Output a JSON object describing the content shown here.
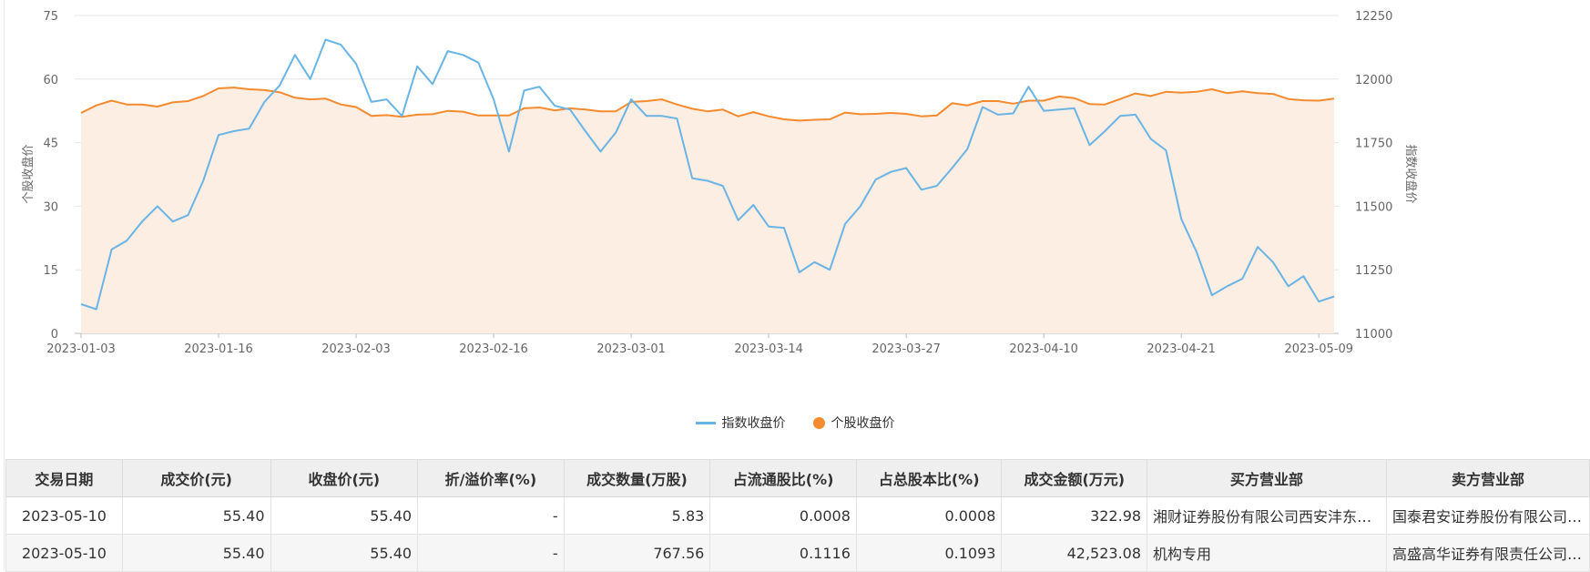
{
  "chart_data": {
    "type": "line",
    "ylabel": "个股收盘价",
    "y2label": "指数收盘价",
    "ylim": [
      0,
      75
    ],
    "y2lim": [
      11000,
      12250
    ],
    "yticks": [
      "0",
      "15",
      "30",
      "45",
      "60",
      "75"
    ],
    "y2ticks": [
      "11000",
      "11250",
      "11500",
      "11750",
      "12000",
      "12250"
    ],
    "xtick_labels": [
      "2023-01-03",
      "2023-01-16",
      "2023-02-03",
      "2023-02-16",
      "2023-03-01",
      "2023-03-14",
      "2023-03-27",
      "2023-04-10",
      "2023-04-21",
      "2023-05-09"
    ],
    "xtick_index": [
      0,
      9,
      18,
      27,
      36,
      45,
      54,
      63,
      72,
      81
    ],
    "legend_position": "bottom",
    "series": [
      {
        "name": "指数收盘价",
        "axis": "right",
        "color": "#6ab4e5",
        "values": [
          11115,
          11095,
          11330,
          11365,
          11440,
          11500,
          11440,
          11465,
          11600,
          11780,
          11795,
          11805,
          11910,
          11975,
          12095,
          12000,
          12155,
          12135,
          12060,
          11910,
          11920,
          11855,
          12050,
          11980,
          12110,
          12095,
          12065,
          11920,
          11715,
          11955,
          11970,
          11895,
          11880,
          11795,
          11715,
          11790,
          11920,
          11855,
          11855,
          11845,
          11610,
          11600,
          11580,
          11445,
          11505,
          11420,
          11415,
          11240,
          11280,
          11250,
          11430,
          11500,
          11605,
          11635,
          11650,
          11565,
          11580,
          11650,
          11725,
          11890,
          11860,
          11865,
          11970,
          11875,
          11880,
          11885,
          11740,
          11795,
          11855,
          11860,
          11765,
          11720,
          11450,
          11320,
          11150,
          11185,
          11215,
          11340,
          11280,
          11185,
          11225,
          11125,
          11145
        ]
      },
      {
        "name": "个股收盘价",
        "axis": "left",
        "color": "#f58b2e",
        "values": [
          52.0,
          53.8,
          54.9,
          54.0,
          54.0,
          53.5,
          54.5,
          54.8,
          56.0,
          57.8,
          58.0,
          57.6,
          57.4,
          56.9,
          55.6,
          55.2,
          55.4,
          54.0,
          53.4,
          51.3,
          51.5,
          51.1,
          51.6,
          51.7,
          52.5,
          52.3,
          51.4,
          51.4,
          51.4,
          53.1,
          53.3,
          52.6,
          53.1,
          52.8,
          52.4,
          52.4,
          54.6,
          54.8,
          55.2,
          54.0,
          53.0,
          52.4,
          52.8,
          51.2,
          52.2,
          51.2,
          50.5,
          50.2,
          50.4,
          50.5,
          52.1,
          51.7,
          51.8,
          52.0,
          51.8,
          51.2,
          51.4,
          54.3,
          53.8,
          54.8,
          54.8,
          54.2,
          54.9,
          54.9,
          55.9,
          55.5,
          54.1,
          54.0,
          55.3,
          56.6,
          56.0,
          57.0,
          56.8,
          57.0,
          57.6,
          56.7,
          57.1,
          56.7,
          56.5,
          55.3,
          55.0,
          54.9,
          55.4
        ]
      }
    ]
  },
  "table": {
    "headers": [
      "交易日期",
      "成交价(元)",
      "收盘价(元)",
      "折/溢价率(%)",
      "成交数量(万股)",
      "占流通股比(%)",
      "占总股本比(%)",
      "成交金额(万元)",
      "买方营业部",
      "卖方营业部"
    ],
    "rows": [
      [
        "2023-05-10",
        "55.40",
        "55.40",
        "-",
        "5.83",
        "0.0008",
        "0.0008",
        "322.98",
        "湘财证券股份有限公司西安沣东新城第一分公司",
        "国泰君安证券股份有限公司总部"
      ],
      [
        "2023-05-10",
        "55.40",
        "55.40",
        "-",
        "767.56",
        "0.1116",
        "0.1093",
        "42,523.08",
        "机构专用",
        "高盛高华证券有限责任公司上海浦东新区世纪大道证券营业部"
      ]
    ]
  }
}
